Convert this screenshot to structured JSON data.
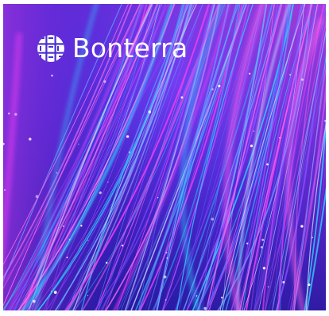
{
  "brand": {
    "name": "Bonterra",
    "logo_icon": "woven-globe-icon",
    "text_color": "#ffffff"
  },
  "background": {
    "description_colors": {
      "deep_blue": "#2a1fc4",
      "violet": "#7a2cf0",
      "magenta": "#e23cf2",
      "cyan": "#2fd2ff"
    },
    "icon": "light-streaks-artwork"
  }
}
